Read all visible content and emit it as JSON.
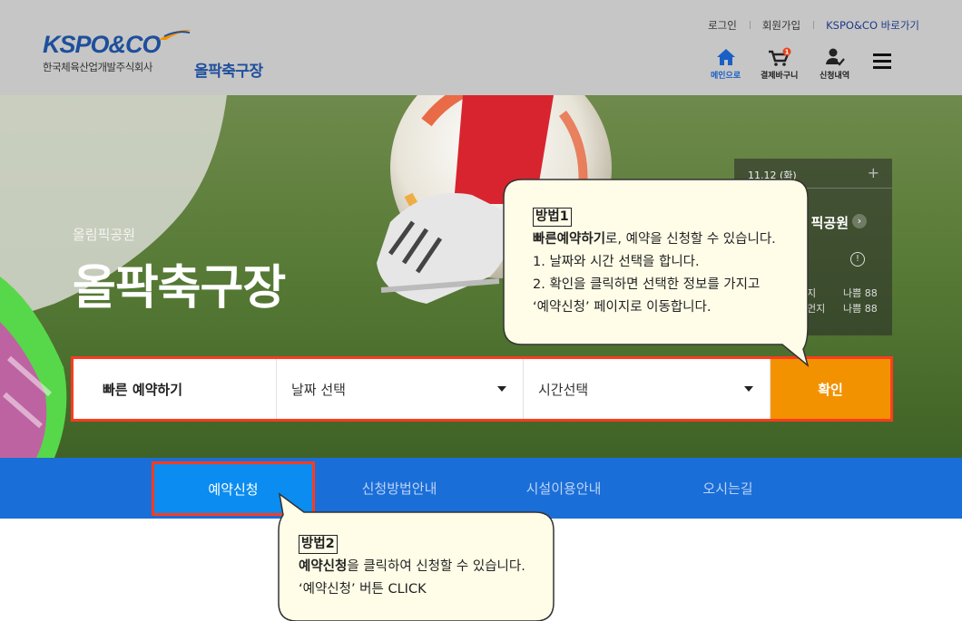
{
  "header": {
    "logo_text": "KSPO&CO",
    "logo_sub": "한국체육산업개발주식회사",
    "site_title": "올팍축구장",
    "top_links": [
      "로그인",
      "회원가입",
      "KSPO&CO 바로가기"
    ],
    "quick_links": [
      {
        "label": "메인으로",
        "icon": "home-icon"
      },
      {
        "label": "결제바구니",
        "icon": "cart-icon",
        "badge": "1"
      },
      {
        "label": "신청내역",
        "icon": "user-check-icon"
      }
    ]
  },
  "hero": {
    "subtitle": "올림픽공원",
    "title": "올팍축구장"
  },
  "notice": {
    "date": "11.12 (화)",
    "plus": "+",
    "park": "픽공원",
    "rows": [
      {
        "key": "지",
        "value": "나쁨 88"
      },
      {
        "key": "먼지",
        "value": "나쁨 88"
      }
    ]
  },
  "booking": {
    "label": "빠른 예약하기",
    "date_select": "날짜 선택",
    "time_select": "시간선택",
    "confirm": "확인"
  },
  "nav": {
    "items": [
      "예약신청",
      "신청방법안내",
      "시설이용안내",
      "오시는길"
    ],
    "active_index": 0
  },
  "callouts": {
    "method1": {
      "heading": "방법1",
      "line1_bold": "빠른예약하기",
      "line1_rest": "로, 예약을 신청할 수 있습니다.",
      "line2": "1. 날짜와 시간 선택을 합니다.",
      "line3": "2. 확인을 클릭하면 선택한 정보를 가지고",
      "line4": "‘예약신청’ 페이지로 이동합니다."
    },
    "method2": {
      "heading": "방법2",
      "line1_bold": "예약신청",
      "line1_rest": "을 클릭하여 신청할 수 있습니다.",
      "line2": "‘예약신청’ 버튼 CLICK"
    }
  },
  "colors": {
    "brand_blue": "#1e4f9c",
    "nav_blue": "#1a6ed8",
    "active_blue": "#0a8cf0",
    "confirm_orange": "#f39200",
    "highlight_red": "#ff3b1f",
    "callout_bg": "#fffde8"
  }
}
